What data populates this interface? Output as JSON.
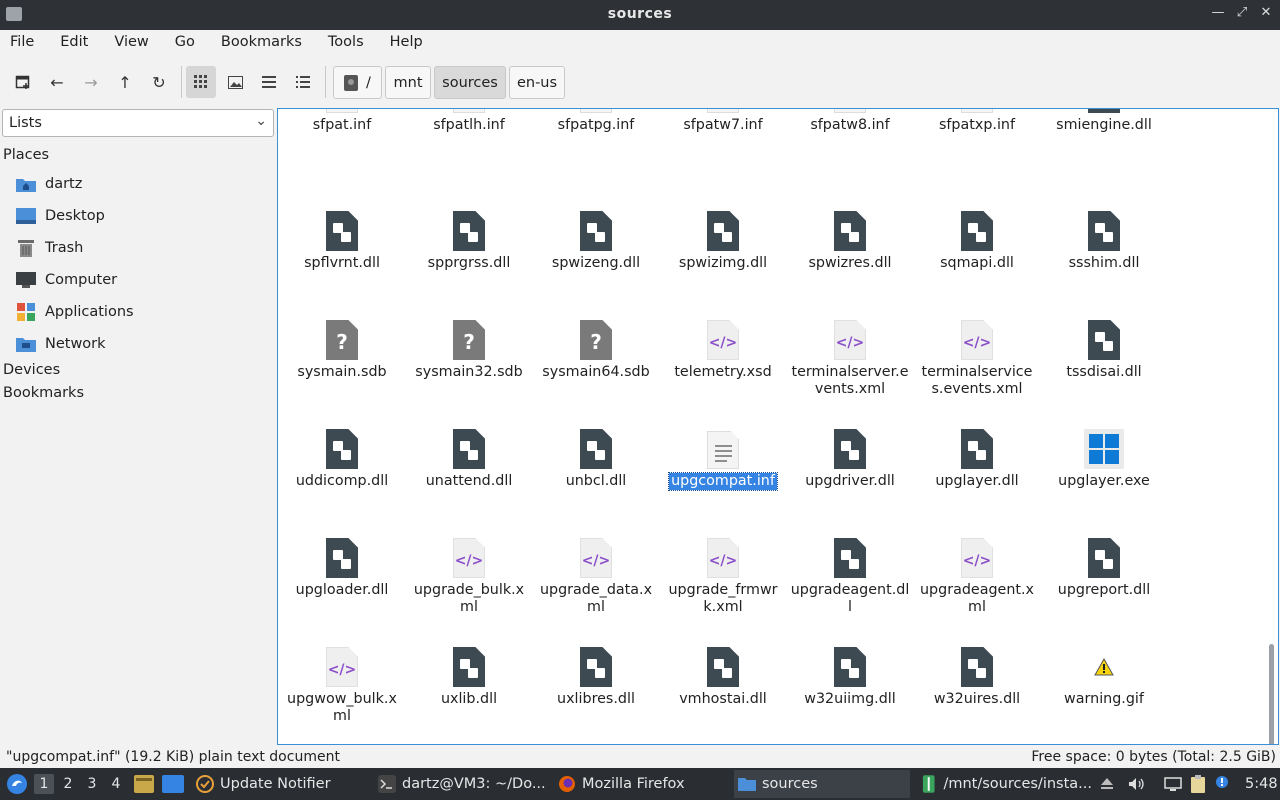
{
  "window": {
    "title": "sources"
  },
  "menu": [
    "File",
    "Edit",
    "View",
    "Go",
    "Bookmarks",
    "Tools",
    "Help"
  ],
  "path": {
    "root": "/",
    "segments": [
      "mnt",
      "sources",
      "en-us"
    ],
    "active": "sources"
  },
  "side": {
    "selector": "Lists",
    "places_title": "Places",
    "places": [
      "dartz",
      "Desktop",
      "Trash",
      "Computer",
      "Applications",
      "Network"
    ],
    "devices_title": "Devices",
    "bookmarks_title": "Bookmarks"
  },
  "files": [
    {
      "name": "sfpat.inf",
      "type": "inf"
    },
    {
      "name": "sfpatlh.inf",
      "type": "inf"
    },
    {
      "name": "sfpatpg.inf",
      "type": "inf"
    },
    {
      "name": "sfpatw7.inf",
      "type": "inf"
    },
    {
      "name": "sfpatw8.inf",
      "type": "inf"
    },
    {
      "name": "sfpatxp.inf",
      "type": "inf"
    },
    {
      "name": "smiengine.dll",
      "type": "dll"
    },
    {
      "name": "spflvrnt.dll",
      "type": "dll"
    },
    {
      "name": "spprgrss.dll",
      "type": "dll"
    },
    {
      "name": "spwizeng.dll",
      "type": "dll"
    },
    {
      "name": "spwizimg.dll",
      "type": "dll"
    },
    {
      "name": "spwizres.dll",
      "type": "dll"
    },
    {
      "name": "sqmapi.dll",
      "type": "dll"
    },
    {
      "name": "ssshim.dll",
      "type": "dll"
    },
    {
      "name": "sysmain.sdb",
      "type": "sdb"
    },
    {
      "name": "sysmain32.sdb",
      "type": "sdb"
    },
    {
      "name": "sysmain64.sdb",
      "type": "sdb"
    },
    {
      "name": "telemetry.xsd",
      "type": "xml"
    },
    {
      "name": "terminalserver.events.xml",
      "type": "xml"
    },
    {
      "name": "terminalservices.events.xml",
      "type": "xml"
    },
    {
      "name": "tssdisai.dll",
      "type": "dll"
    },
    {
      "name": "uddicomp.dll",
      "type": "dll"
    },
    {
      "name": "unattend.dll",
      "type": "dll"
    },
    {
      "name": "unbcl.dll",
      "type": "dll"
    },
    {
      "name": "upgcompat.inf",
      "type": "inf",
      "selected": true
    },
    {
      "name": "upgdriver.dll",
      "type": "dll"
    },
    {
      "name": "upglayer.dll",
      "type": "dll"
    },
    {
      "name": "upglayer.exe",
      "type": "exe"
    },
    {
      "name": "upgloader.dll",
      "type": "dll"
    },
    {
      "name": "upgrade_bulk.xml",
      "type": "xml"
    },
    {
      "name": "upgrade_data.xml",
      "type": "xml"
    },
    {
      "name": "upgrade_frmwrk.xml",
      "type": "xml"
    },
    {
      "name": "upgradeagent.dll",
      "type": "dll"
    },
    {
      "name": "upgradeagent.xml",
      "type": "xml"
    },
    {
      "name": "upgreport.dll",
      "type": "dll"
    },
    {
      "name": "upgwow_bulk.xml",
      "type": "xml"
    },
    {
      "name": "uxlib.dll",
      "type": "dll"
    },
    {
      "name": "uxlibres.dll",
      "type": "dll"
    },
    {
      "name": "vmhostai.dll",
      "type": "dll"
    },
    {
      "name": "w32uiimg.dll",
      "type": "dll"
    },
    {
      "name": "w32uires.dll",
      "type": "dll"
    },
    {
      "name": "warning.gif",
      "type": "gif"
    }
  ],
  "status": {
    "selection": "\"upgcompat.inf\" (19.2 KiB) plain text document",
    "free_space": "Free space: 0 bytes (Total: 2.5 GiB)"
  },
  "taskbar": {
    "workspaces": [
      "1",
      "2",
      "3",
      "4"
    ],
    "tasks": [
      "Update Notifier",
      "dartz@VM3: ~/Do...",
      "Mozilla Firefox",
      "sources",
      "/mnt/sources/insta..."
    ],
    "active_task": "sources",
    "clock": "5:48"
  },
  "colors": {
    "accent": "#3584e4",
    "selection_border": "#3b8fd6",
    "panel": "#2a2e33"
  }
}
